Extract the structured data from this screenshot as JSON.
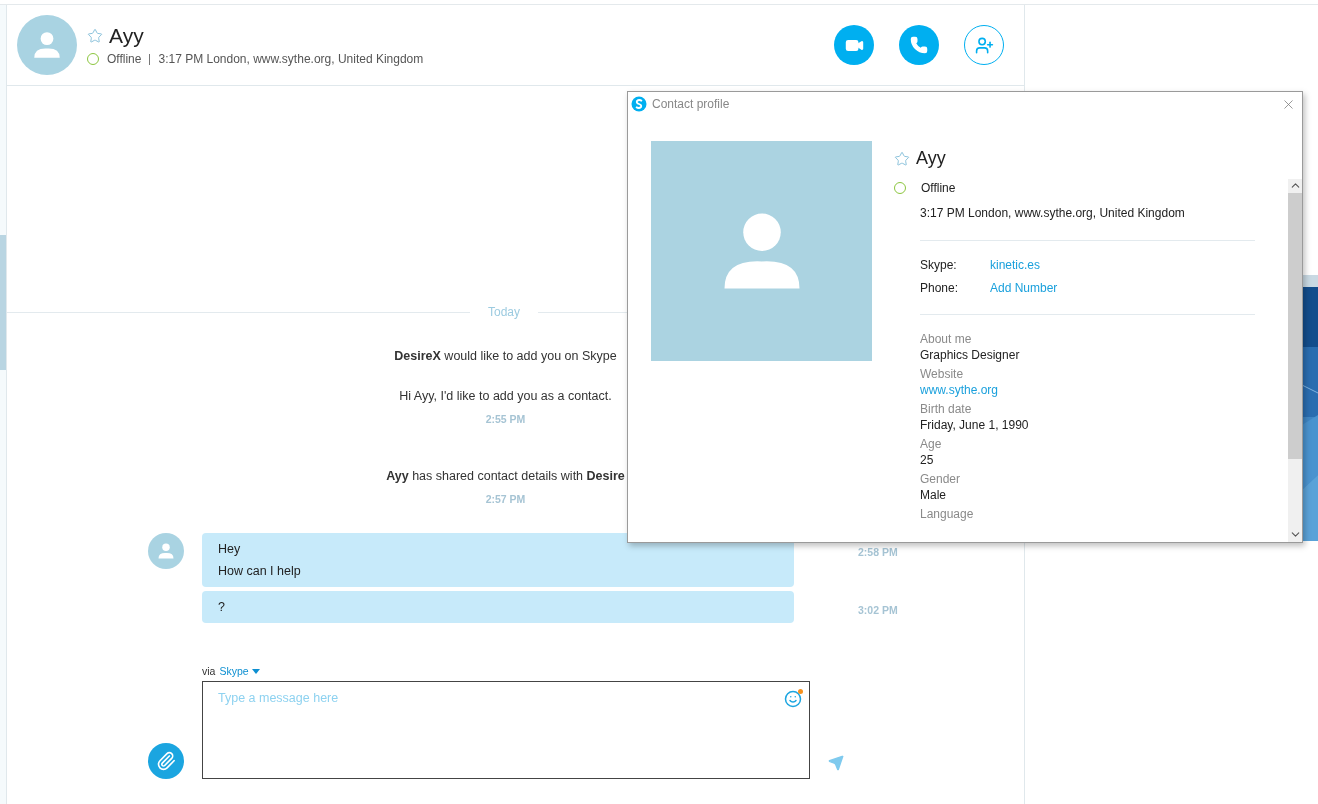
{
  "contact": {
    "name": "Ayy",
    "favorite": false,
    "status": "Offline",
    "location": "3:17 PM London, www.sythe.org, United Kingdom"
  },
  "conversation": {
    "divider": "Today",
    "notices": [
      {
        "lines": [
          "**DesireX** would like to add you on Skype",
          "Hi Ayy, I'd like to add you as a contact."
        ],
        "time": "2:55 PM"
      },
      {
        "lines": [
          "**Ayy** has shared contact details with **Desire**"
        ],
        "time": "2:57 PM"
      }
    ],
    "messages": [
      {
        "lines": [
          "Hey",
          "How can I help"
        ],
        "time": "2:58 PM",
        "avatar": true
      },
      {
        "lines": [
          "?"
        ],
        "time": "3:02 PM",
        "avatar": false
      }
    ]
  },
  "composer": {
    "via": "via",
    "service": "Skype",
    "placeholder": "Type a message here",
    "emoticon_notice": true
  },
  "profile_dialog": {
    "title": "Contact profile",
    "name": "Ayy",
    "favorite": false,
    "status": "Offline",
    "location": "3:17 PM London, www.sythe.org, United Kingdom",
    "accounts": [
      {
        "label": "Skype:",
        "value": "kinetic.es"
      },
      {
        "label": "Phone:",
        "value": "Add Number"
      }
    ],
    "details": [
      {
        "label": "About me",
        "value": "Graphics Designer",
        "kind": "text"
      },
      {
        "label": "Website",
        "value": "www.sythe.org",
        "kind": "link"
      },
      {
        "label": "Birth date",
        "value": "Friday, June 1, 1990",
        "kind": "text"
      },
      {
        "label": "Age",
        "value": "25",
        "kind": "text"
      },
      {
        "label": "Gender",
        "value": "Male",
        "kind": "text"
      },
      {
        "label": "Language"
      }
    ]
  }
}
